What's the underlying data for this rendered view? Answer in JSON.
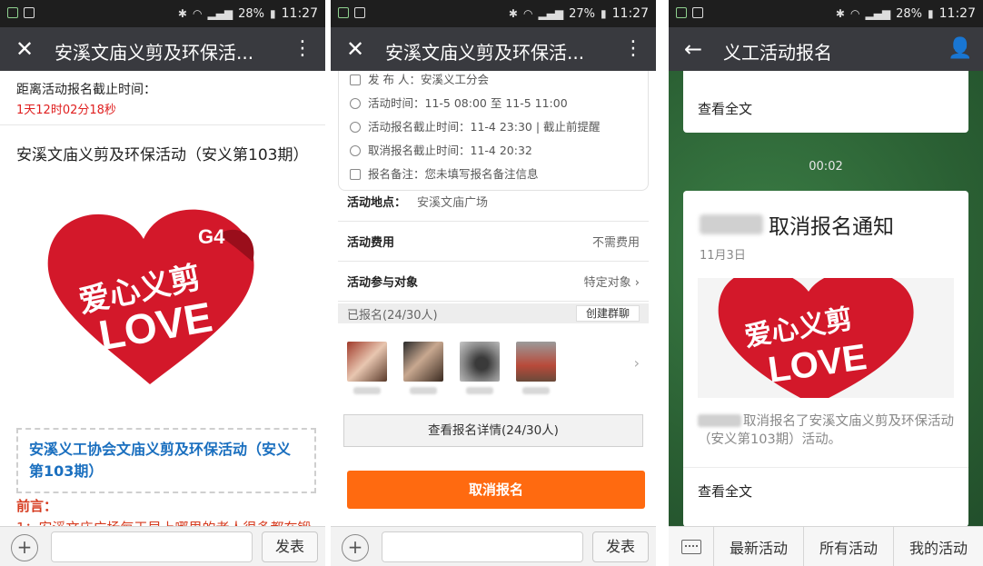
{
  "status_bars": [
    {
      "battery": "28%",
      "time": "11:27"
    },
    {
      "battery": "27%",
      "time": "11:27"
    },
    {
      "battery": "28%",
      "time": "11:27"
    }
  ],
  "screen1": {
    "title": "安溪文庙义剪及环保活...",
    "deadline_label": "距离活动报名截止时间：",
    "deadline_value": "1天12时02分18秒",
    "activity_title": "安溪文庙义剪及环保活动（安义第103期）",
    "heart_image": {
      "tag": "G4",
      "line1": "爱心义剪",
      "line2": "LOVE"
    },
    "info_box": "安溪义工协会文庙义剪及环保活动（安义第103期）",
    "preface_label": "前言：",
    "preface_text": "1：安溪文庙广场每天早上哪里的老人很多都在锻",
    "send_label": "发表"
  },
  "screen2": {
    "title": "安溪文庙义剪及环保活...",
    "publisher": "发 布 人：安溪义工分会",
    "activity_time": "活动时间：11-5 08:00 至 11-5 11:00",
    "signup_deadline": "活动报名截止时间：11-4 23:30 | 截止前提醒",
    "cancel_deadline": "取消报名截止时间：11-4 20:32",
    "remark": "报名备注：您未填写报名备注信息",
    "location_label": "活动地点：",
    "location_value": "安溪文庙广场",
    "fee_label": "活动费用",
    "fee_value": "不需费用",
    "target_label": "活动参与对象",
    "target_value": "特定对象",
    "signed_label": "已报名(24/30人)",
    "group_chat": "创建群聊",
    "details_button": "查看报名详情(24/30人)",
    "cancel_button": "取消报名",
    "send_label": "发表"
  },
  "screen3": {
    "title": "义工活动报名",
    "read_full_top": "查看全文",
    "timestamp": "00:02",
    "notice_title": "取消报名通知",
    "notice_date": "11月3日",
    "notice_desc": "取消报名了安溪文庙义剪及环保活动（安义第103期）活动。",
    "read_full": "查看全文",
    "menu": [
      "最新活动",
      "所有活动",
      "我的活动"
    ]
  },
  "colors": {
    "titlebar": "#393a3f",
    "accent_orange": "#ff6a10",
    "countdown_red": "#e02020",
    "link_blue": "#1a6fbf",
    "wechat_green_bg": "#2f6b3a",
    "heart_red": "#d3182a"
  }
}
